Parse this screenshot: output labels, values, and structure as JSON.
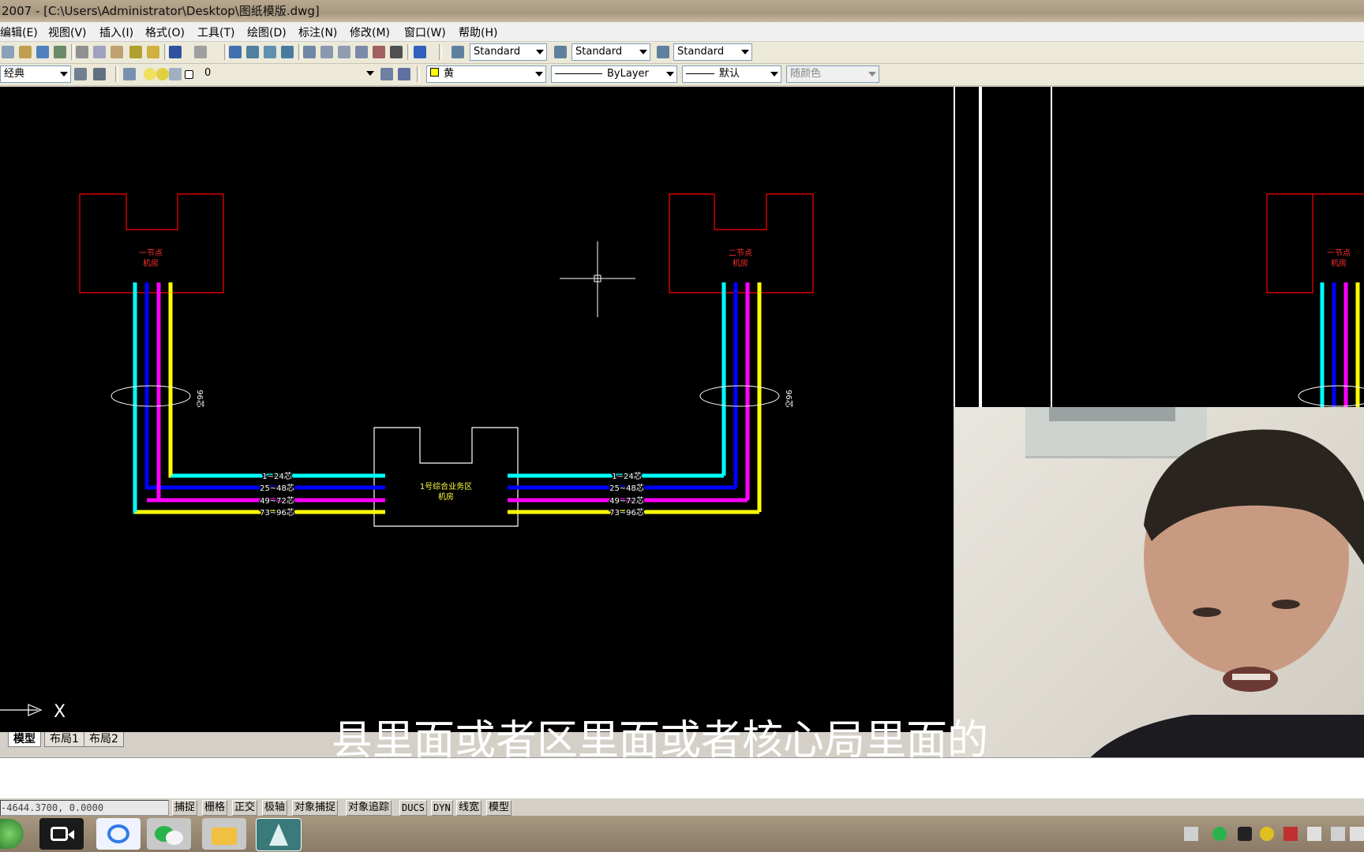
{
  "window": {
    "title": "2007 - [C:\\Users\\Administrator\\Desktop\\图纸模版.dwg]"
  },
  "menu": [
    "编辑(E)",
    "视图(V)",
    "插入(I)",
    "格式(O)",
    "工具(T)",
    "绘图(D)",
    "标注(N)",
    "修改(M)",
    "窗口(W)",
    "帮助(H)"
  ],
  "toolbar1": {
    "text_style": "Standard",
    "dim_style": "Standard",
    "table_style": "Standard"
  },
  "toolbar2": {
    "workspace": "经典",
    "layer": "0",
    "color": "黄",
    "linetype": "ByLayer",
    "lineweight": "默认",
    "plotstyle": "随颜色"
  },
  "drawing": {
    "node1_label_line1": "一节点",
    "node1_label_line2": "机房",
    "node2_label_line1": "二节点",
    "node2_label_line2": "机房",
    "center_label_line1": "1号综合业务区",
    "center_label_line2": "机房",
    "core_labels": [
      "1~24芯",
      "25~48芯",
      "49~72芯",
      "73~96芯"
    ],
    "cable_label": "96芯",
    "axis_x": "X",
    "colors": {
      "cyan": "#00ffff",
      "blue": "#0000ff",
      "magenta": "#ff00ff",
      "yellow": "#ffff00",
      "red": "#ff0000"
    }
  },
  "layout_tabs": [
    "模型",
    "布局1",
    "布局2"
  ],
  "subtitle": "县里面或者区里面或者核心局里面的",
  "status": {
    "coords": "-4644.3700, 0.0000",
    "buttons": [
      "捕捉",
      "栅格",
      "正交",
      "极轴",
      "对象捕捉",
      "对象追踪",
      "DUCS",
      "DYN",
      "线宽",
      "模型"
    ]
  }
}
